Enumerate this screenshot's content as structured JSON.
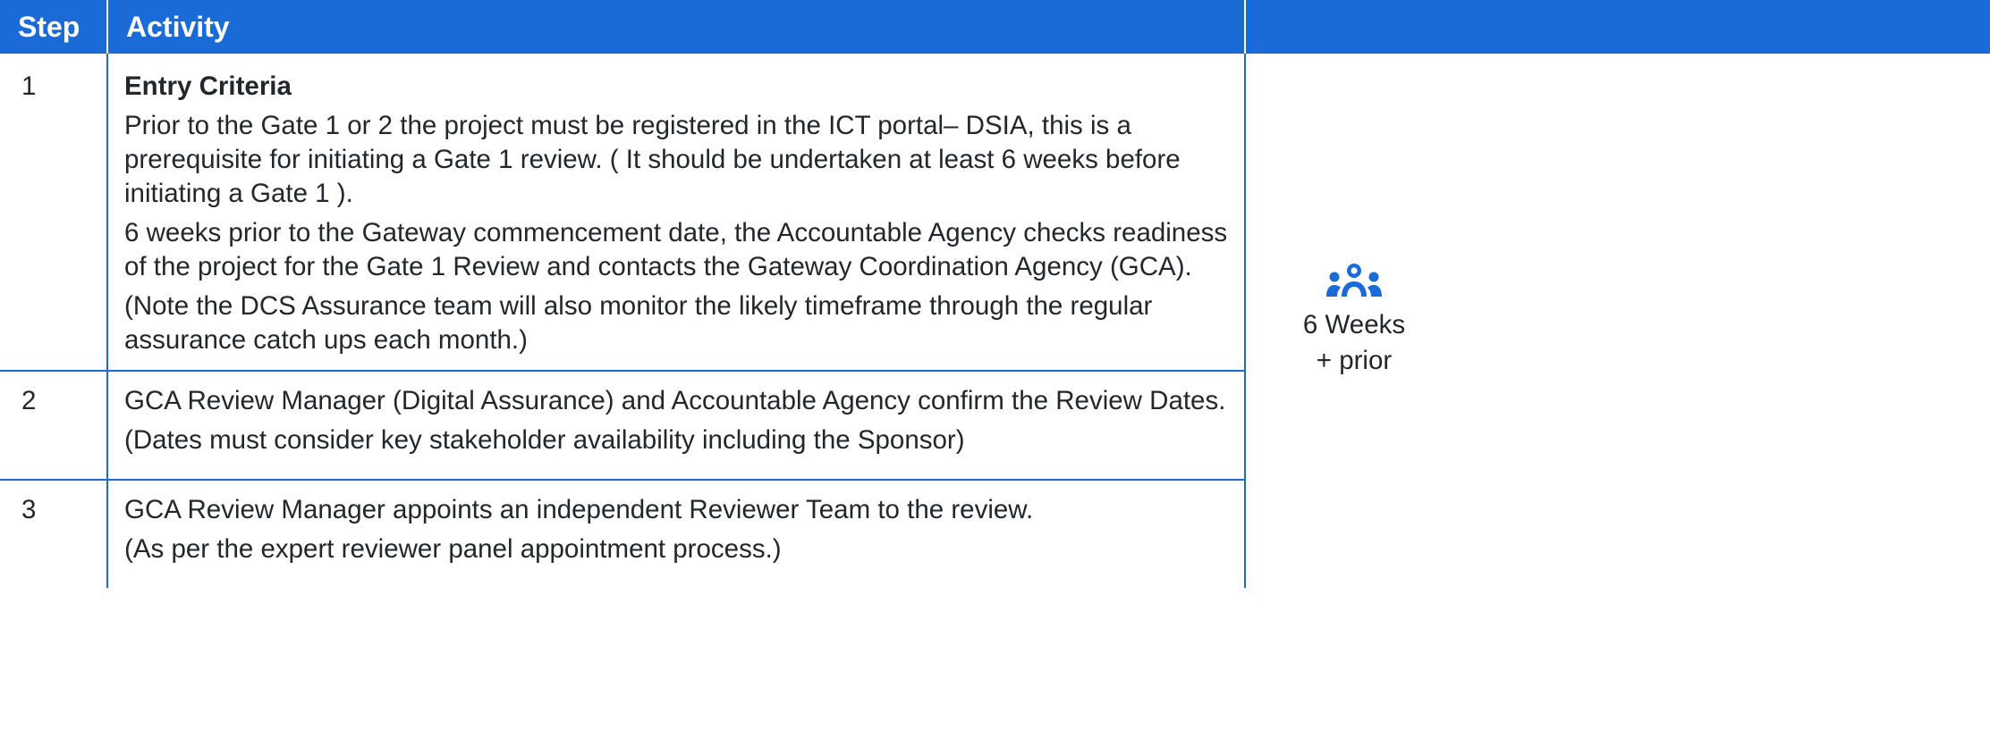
{
  "table": {
    "headers": {
      "step": "Step",
      "activity": "Activity",
      "timing": ""
    },
    "rows": [
      {
        "step": "1",
        "heading": "Entry Criteria",
        "paragraphs": [
          "Prior to the Gate 1 or 2 the project must be registered in the ICT portal– DSIA, this is a prerequisite for initiating a Gate 1 review. ( It should be undertaken at least 6 weeks before initiating a Gate 1 ).",
          "6 weeks prior to the Gateway commencement date, the Accountable Agency checks readiness of the project for the Gate 1  Review and contacts the Gateway Coordination Agency (GCA).",
          "(Note the DCS Assurance team will also monitor the likely timeframe through the regular assurance catch ups each month.)"
        ]
      },
      {
        "step": "2",
        "paragraphs": [
          "GCA Review Manager (Digital Assurance) and Accountable Agency confirm the Review Dates.",
          "(Dates must consider key stakeholder availability including the Sponsor)"
        ]
      },
      {
        "step": "3",
        "paragraphs": [
          "GCA Review Manager appoints an independent Reviewer Team to the review.",
          "(As per the expert reviewer panel appointment process.)"
        ]
      }
    ],
    "timing": {
      "icon": "people-group-icon",
      "line1": "6 Weeks",
      "line2": "+ prior"
    }
  },
  "colors": {
    "header_bg": "#1a6bd8",
    "header_text": "#ffffff",
    "border": "#1a6bd8",
    "icon": "#1a6bd8",
    "body_text": "#22272b"
  }
}
